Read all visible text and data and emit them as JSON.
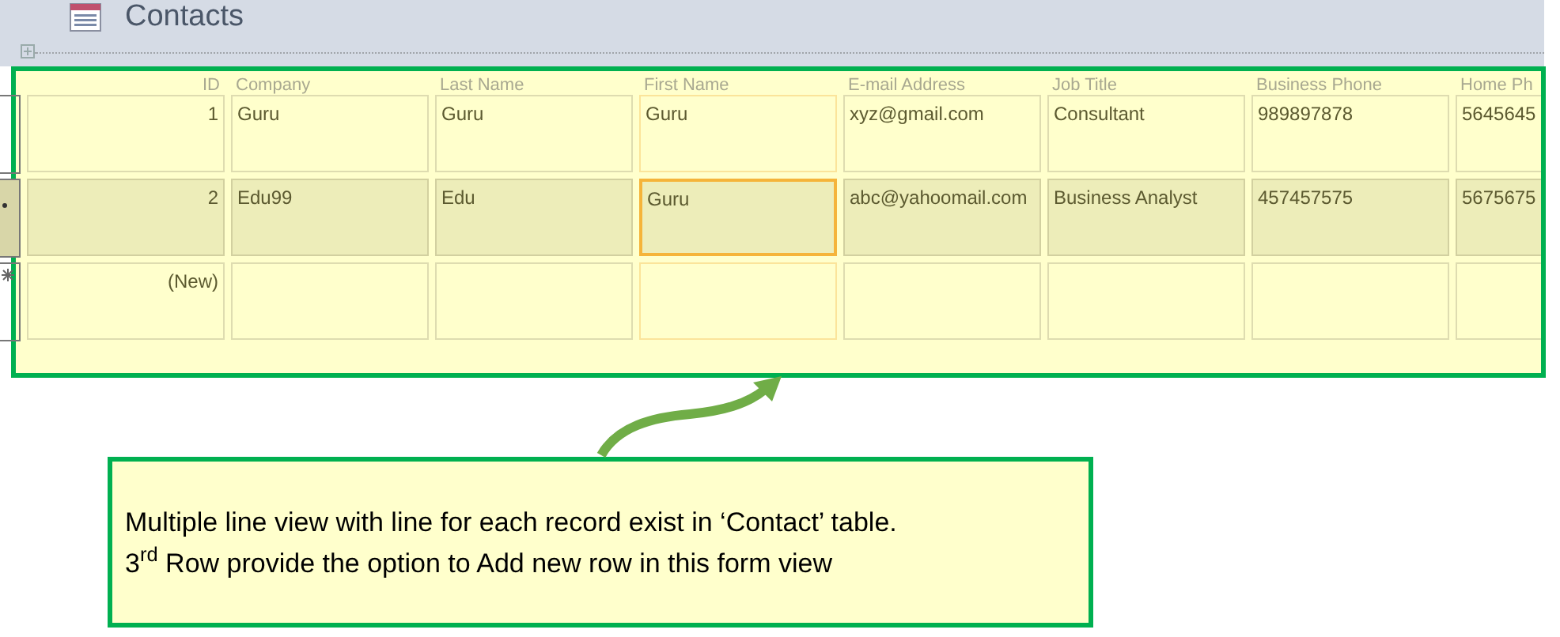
{
  "form_title": "Contacts",
  "columns": [
    {
      "label": "ID",
      "kind": "number",
      "active": false
    },
    {
      "label": "Company",
      "kind": "text",
      "active": false
    },
    {
      "label": "Last Name",
      "kind": "text",
      "active": false
    },
    {
      "label": "First Name",
      "kind": "text",
      "active": true
    },
    {
      "label": "E-mail Address",
      "kind": "text",
      "active": false
    },
    {
      "label": "Job Title",
      "kind": "text",
      "active": false
    },
    {
      "label": "Business Phone",
      "kind": "text",
      "active": false
    },
    {
      "label": "Home Ph",
      "kind": "text",
      "active": false
    }
  ],
  "rows": [
    {
      "kind": "record",
      "current": false,
      "cells": [
        "1",
        "Guru",
        "Guru",
        "Guru",
        "xyz@gmail.com",
        "Consultant",
        "989897878",
        "5645645"
      ]
    },
    {
      "kind": "record",
      "current": true,
      "cells": [
        "2",
        "Edu99",
        "Edu",
        "Guru",
        "abc@yahoomail.com",
        "Business Analyst",
        "457457575",
        "5675675"
      ]
    },
    {
      "kind": "new",
      "current": false,
      "cells": [
        "(New)",
        "",
        "",
        "",
        "",
        "",
        "",
        ""
      ]
    }
  ],
  "callout": {
    "lines": [
      "Multiple line view with line for each record exist in ‘Contact’ table.",
      "3$^{rd}$ Row provide the option to Add new row in this form view"
    ]
  }
}
